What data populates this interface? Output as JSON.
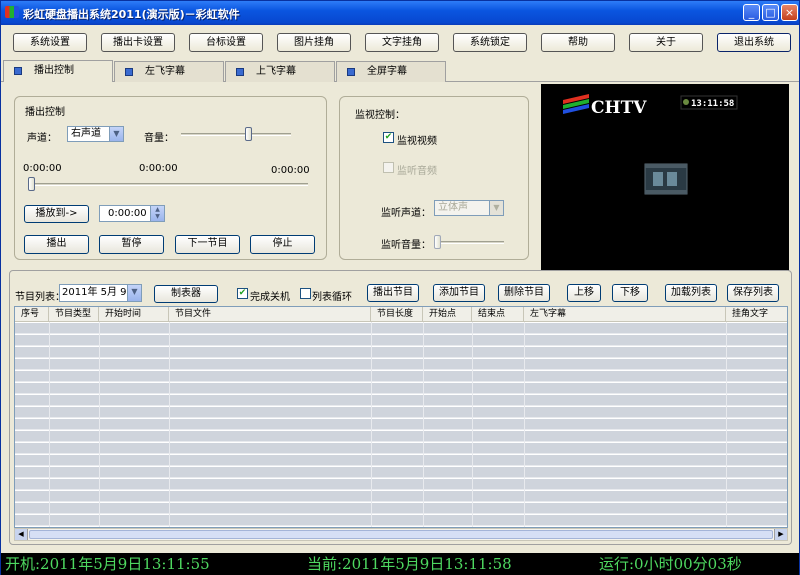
{
  "window": {
    "title": "彩虹硬盘播出系统2011(演示版)－彩虹软件",
    "min_label": "_",
    "max_label": "□",
    "close_label": "×"
  },
  "toolbar": [
    "系统设置",
    "播出卡设置",
    "台标设置",
    "图片挂角",
    "文字挂角",
    "系统锁定",
    "帮助",
    "关于",
    "退出系统"
  ],
  "tabs": [
    "播出控制",
    "左飞字幕",
    "上飞字幕",
    "全屏字幕"
  ],
  "playback": {
    "group_title": "播出控制",
    "channel_label": "声道：",
    "channel_value": "右声道",
    "volume_label": "音量：",
    "volume_level": 0.62,
    "time_start": "0:00:00",
    "time_mid": "0:00:00",
    "time_end": "0:00:00",
    "progress": 0.0,
    "play_to_label": "播放到->",
    "play_to_time": "0:00:00",
    "buttons": [
      "播出",
      "暂停",
      "下一节目",
      "停止"
    ]
  },
  "monitor": {
    "group_title": "监视控制：",
    "video_label": "监视视频",
    "video_checked": true,
    "audio_label": "监听音频",
    "audio_checked": false,
    "channel_label": "监听声道：",
    "channel_value": "立体声",
    "volume_label": "监听音量：",
    "volume_level": 0.0
  },
  "preview": {
    "logo_text": "CHTV",
    "clock": "13:11:58"
  },
  "program_list": {
    "label": "节目列表：",
    "date": "2011年 5月 9日",
    "scheduler_label": "制表器",
    "shutdown_label": "完成关机",
    "shutdown_checked": true,
    "loop_label": "列表循环",
    "loop_checked": false,
    "buttons": [
      "播出节目",
      "添加节目",
      "删除节目",
      "上移",
      "下移",
      "加载列表",
      "保存列表"
    ],
    "columns": [
      "序号",
      "节目类型",
      "开始时间",
      "节目文件",
      "节目长度",
      "开始点",
      "结束点",
      "左飞字幕",
      "挂角文字"
    ]
  },
  "status": {
    "boot_time": "开机:2011年5月9日13:11:55",
    "current_time": "当前:2011年5月9日13:11:58",
    "run_time": "运行:0小时00分03秒"
  }
}
